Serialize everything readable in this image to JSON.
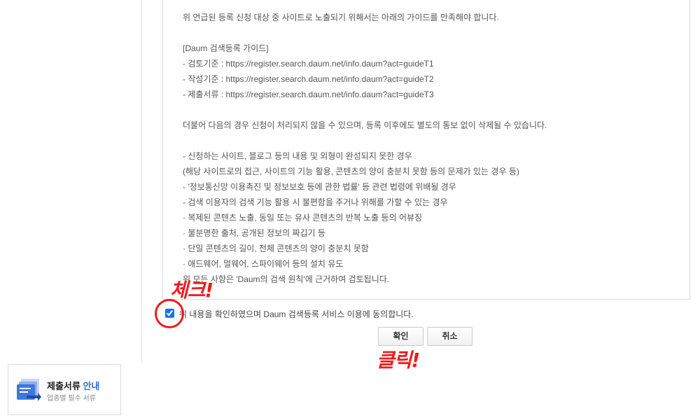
{
  "terms": {
    "lines": [
      "위 언급된 등록 신청 대상 중 사이트로 노출되기 위해서는 아래의 가이드를 만족해야 합니다.",
      "",
      "[Daum 검색등록 가이드]",
      "- 검토기준 : https://register.search.daum.net/info.daum?act=guideT1",
      "- 작성기준 : https://register.search.daum.net/info.daum?act=guideT2",
      "- 제출서류 : https://register.search.daum.net/info.daum?act=guideT3",
      "",
      "더불어 다음의 경우 신청이 처리되지 않을 수 있으며, 등록 이후에도 별도의 통보 없이 삭제될 수 있습니다.",
      "",
      "- 신청하는 사이트, 블로그 등의 내용 및 외형이 완성되지 못한 경우",
      "  (해당 사이트로의 접근, 사이트의 기능 활용, 콘텐츠의 양이 충분치 못함 등의 문제가 있는 경우 등)",
      "- '정보통신망 이용촉진 및 정보보호 등에 관한 법률' 등 관련 법령에 위배될 경우",
      "- 검색 이용자의 검색 기능 활용 시 불편함을 주거나 위해를 가할 수 있는 경우",
      "  · 복제된 콘텐츠 노출, 동일 또는 유사 콘텐츠의 반복 노출 등의 어뷰징",
      "  · 불분명한 출처, 공개된 정보의 짜깁기 등",
      "  · 단일 콘텐츠의 길이, 전체 콘텐츠의 양이 충분치 못함",
      "  · 애드웨어, 멀웨어, 스파이웨어 등의 설치 유도",
      "  위 모든 사항은 'Daum의 검색 원칙'에 근거하여 검토됩니다."
    ]
  },
  "agreement": {
    "label": "위 내용을 확인하였으며 Daum 검색등록 서비스 이용에 동의합니다.",
    "checked": true
  },
  "buttons": {
    "confirm": "확인",
    "cancel": "취소"
  },
  "annotations": {
    "check": "체크!",
    "click": "클릭!",
    "color": "#ee1c1c"
  },
  "banner": {
    "title_main": "제출서류 ",
    "title_accent": "안내",
    "subtitle": "업종별 필수 서류",
    "icon": "document-stack-icon",
    "accent_color": "#2b6edb"
  }
}
